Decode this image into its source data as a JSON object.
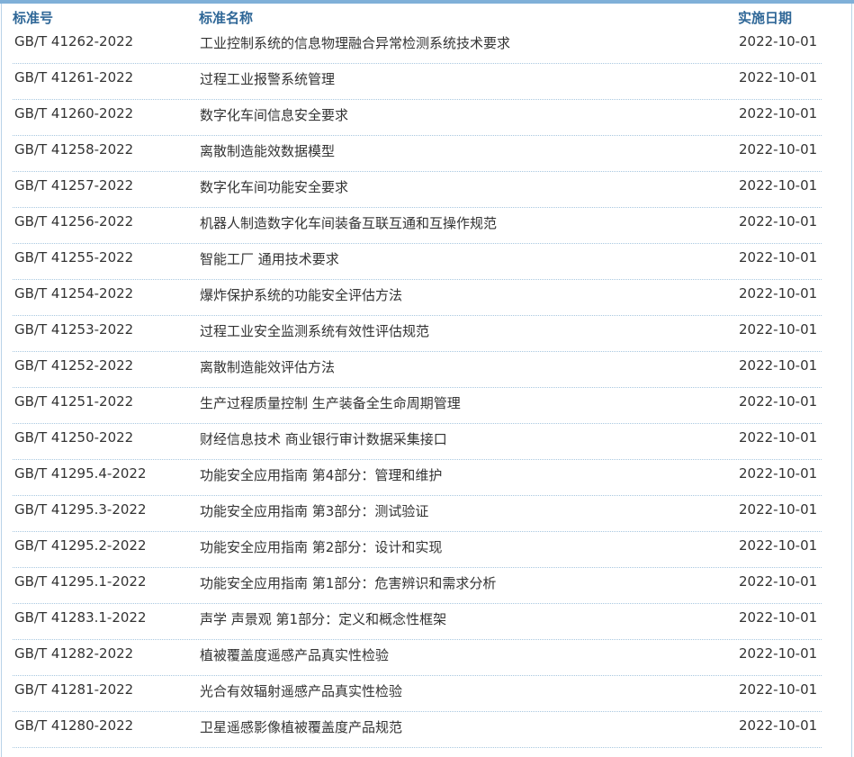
{
  "table": {
    "headers": {
      "code": "标准号",
      "name": "标准名称",
      "date": "实施日期"
    },
    "rows": [
      {
        "code": "GB/T 41262-2022",
        "name": "工业控制系统的信息物理融合异常检测系统技术要求",
        "date": "2022-10-01"
      },
      {
        "code": "GB/T 41261-2022",
        "name": "过程工业报警系统管理",
        "date": "2022-10-01"
      },
      {
        "code": "GB/T 41260-2022",
        "name": "数字化车间信息安全要求",
        "date": "2022-10-01"
      },
      {
        "code": "GB/T 41258-2022",
        "name": "离散制造能效数据模型",
        "date": "2022-10-01"
      },
      {
        "code": "GB/T 41257-2022",
        "name": "数字化车间功能安全要求",
        "date": "2022-10-01"
      },
      {
        "code": "GB/T 41256-2022",
        "name": "机器人制造数字化车间装备互联互通和互操作规范",
        "date": "2022-10-01"
      },
      {
        "code": "GB/T 41255-2022",
        "name": "智能工厂 通用技术要求",
        "date": "2022-10-01"
      },
      {
        "code": "GB/T 41254-2022",
        "name": "爆炸保护系统的功能安全评估方法",
        "date": "2022-10-01"
      },
      {
        "code": "GB/T 41253-2022",
        "name": "过程工业安全监测系统有效性评估规范",
        "date": "2022-10-01"
      },
      {
        "code": "GB/T 41252-2022",
        "name": "离散制造能效评估方法",
        "date": "2022-10-01"
      },
      {
        "code": "GB/T 41251-2022",
        "name": "生产过程质量控制 生产装备全生命周期管理",
        "date": "2022-10-01"
      },
      {
        "code": "GB/T 41250-2022",
        "name": "财经信息技术 商业银行审计数据采集接口",
        "date": "2022-10-01"
      },
      {
        "code": "GB/T 41295.4-2022",
        "name": "功能安全应用指南 第4部分：管理和维护",
        "date": "2022-10-01"
      },
      {
        "code": "GB/T 41295.3-2022",
        "name": "功能安全应用指南 第3部分：测试验证",
        "date": "2022-10-01"
      },
      {
        "code": "GB/T 41295.2-2022",
        "name": "功能安全应用指南 第2部分：设计和实现",
        "date": "2022-10-01"
      },
      {
        "code": "GB/T 41295.1-2022",
        "name": "功能安全应用指南 第1部分：危害辨识和需求分析",
        "date": "2022-10-01"
      },
      {
        "code": "GB/T 41283.1-2022",
        "name": "声学 声景观 第1部分：定义和概念性框架",
        "date": "2022-10-01"
      },
      {
        "code": "GB/T 41282-2022",
        "name": "植被覆盖度遥感产品真实性检验",
        "date": "2022-10-01"
      },
      {
        "code": "GB/T 41281-2022",
        "name": "光合有效辐射遥感产品真实性检验",
        "date": "2022-10-01"
      },
      {
        "code": "GB/T 41280-2022",
        "name": "卫星遥感影像植被覆盖度产品规范",
        "date": "2022-10-01"
      }
    ]
  }
}
